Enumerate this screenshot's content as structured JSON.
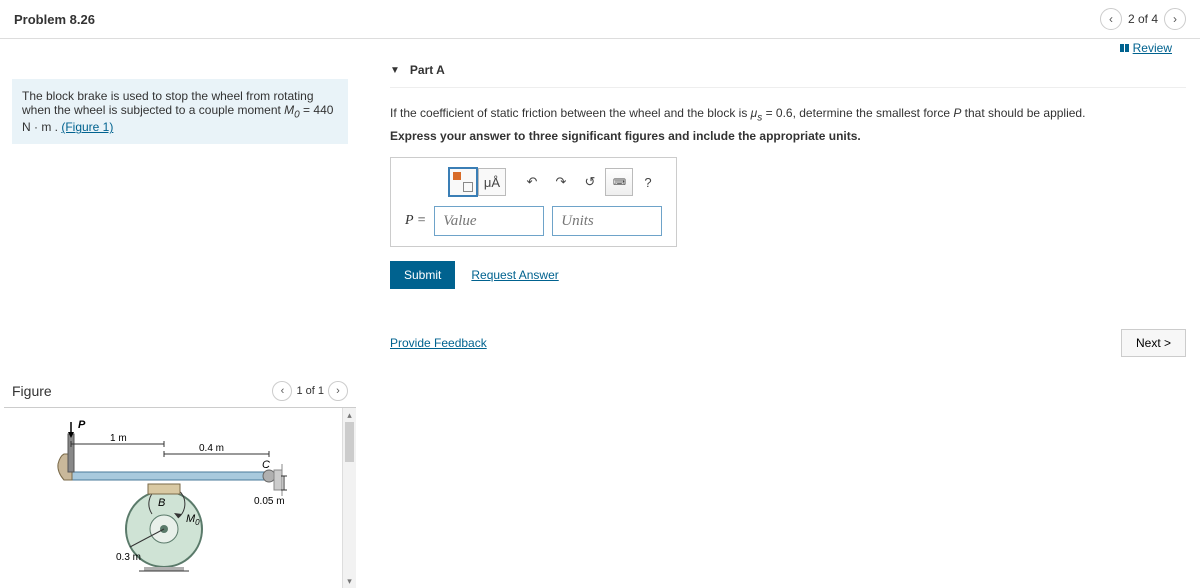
{
  "header": {
    "title": "Problem 8.26",
    "nav_text": "2 of 4",
    "review": "Review"
  },
  "prompt": {
    "text_prefix": "The block brake is used to stop the wheel from rotating when the wheel is subjected to a couple moment ",
    "m_var": "M",
    "m_sub": "0",
    "eq": " = 440  N · m . ",
    "figure_link": "(Figure 1)"
  },
  "figure": {
    "title": "Figure",
    "nav": "1 of 1",
    "labels": {
      "P": "P",
      "B": "B",
      "C": "C",
      "M0": "M",
      "M0sub": "0",
      "d1m": "1 m",
      "d04m": "0.4 m",
      "d005m": "0.05 m",
      "d03m": "0.3 m"
    }
  },
  "part": {
    "label": "Part A",
    "question_prefix": "If the coefficient of static friction between the wheel and the block is ",
    "mu": "μ",
    "mu_sub": "s",
    "question_mid": " = 0.6, determine the smallest force ",
    "P": "P",
    "question_suffix": " that should be applied.",
    "instruction": "Express your answer to three significant figures and include the appropriate units.",
    "tools": {
      "templates": "templates",
      "symbol": "μÅ",
      "undo": "↶",
      "redo": "↷",
      "reset": "↺",
      "keyboard": "⌨",
      "help": "?"
    },
    "input": {
      "label": "P =",
      "value_placeholder": "Value",
      "units_placeholder": "Units"
    },
    "submit": "Submit",
    "request": "Request Answer"
  },
  "footer": {
    "feedback": "Provide Feedback",
    "next": "Next >"
  }
}
